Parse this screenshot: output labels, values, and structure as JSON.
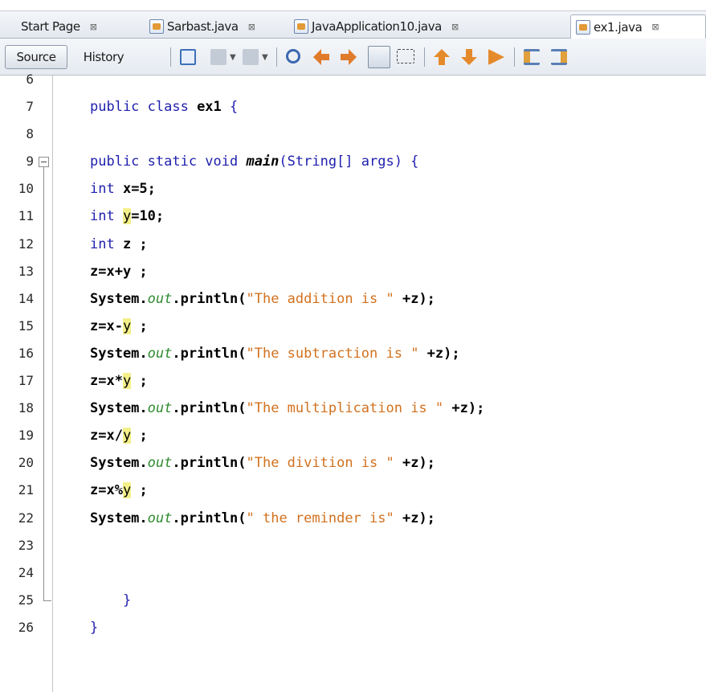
{
  "tabs": [
    {
      "label": "Start Page",
      "active": false,
      "icon": "none"
    },
    {
      "label": "Sarbast.java",
      "active": false,
      "icon": "java-file-icon"
    },
    {
      "label": "JavaApplication10.java",
      "active": false,
      "icon": "java-file-icon"
    },
    {
      "label": "ex1.java",
      "active": true,
      "icon": "java-file-icon"
    }
  ],
  "tab_close_glyph": "⊠",
  "toolbar": {
    "source_label": "Source",
    "history_label": "History",
    "icons": [
      "last-edit-icon",
      "back-icon",
      "forward-icon",
      "find-icon",
      "find-previous-icon",
      "find-next-icon",
      "toggle-highlight-icon",
      "rect-select-icon",
      "previous-bookmark-icon",
      "next-bookmark-icon",
      "toggle-bookmark-icon",
      "shift-left-icon",
      "shift-right-icon"
    ]
  },
  "editor": {
    "partial_top_line": "6",
    "lines": [
      {
        "n": "7",
        "segments": [
          [
            "kw",
            "public class "
          ],
          [
            "nm",
            "ex1"
          ],
          [
            "kw",
            " {"
          ]
        ]
      },
      {
        "n": "8",
        "segments": []
      },
      {
        "n": "9",
        "segments": [
          [
            "kw",
            "public static void "
          ],
          [
            "it",
            "main"
          ],
          [
            "kw",
            "(String[] args) {"
          ]
        ],
        "fold": "start"
      },
      {
        "n": "10",
        "segments": [
          [
            "kw",
            "int "
          ],
          [
            "nm",
            "x=5;"
          ]
        ]
      },
      {
        "n": "11",
        "segments": [
          [
            "kw",
            "int "
          ],
          [
            "hl",
            "y"
          ],
          [
            "nm",
            "=10;"
          ]
        ]
      },
      {
        "n": "12",
        "segments": [
          [
            "kw",
            "int "
          ],
          [
            "nm",
            "z ;"
          ]
        ]
      },
      {
        "n": "13",
        "segments": [
          [
            "nm",
            "z=x+y ;"
          ]
        ]
      },
      {
        "n": "14",
        "segments": [
          [
            "nm",
            "System."
          ],
          [
            "fld",
            "out"
          ],
          [
            "nm",
            ".println("
          ],
          [
            "str",
            "\"The addition is \""
          ],
          [
            "nm",
            " +z);"
          ]
        ]
      },
      {
        "n": "15",
        "segments": [
          [
            "nm",
            "z=x-"
          ],
          [
            "hl",
            "y"
          ],
          [
            "nm",
            " ;"
          ]
        ]
      },
      {
        "n": "16",
        "segments": [
          [
            "nm",
            "System."
          ],
          [
            "fld",
            "out"
          ],
          [
            "nm",
            ".println("
          ],
          [
            "str",
            "\"The subtraction is \""
          ],
          [
            "nm",
            " +z);"
          ]
        ]
      },
      {
        "n": "17",
        "segments": [
          [
            "nm",
            "z=x*"
          ],
          [
            "hl",
            "y"
          ],
          [
            "nm",
            " ;"
          ]
        ]
      },
      {
        "n": "18",
        "segments": [
          [
            "nm",
            "System."
          ],
          [
            "fld",
            "out"
          ],
          [
            "nm",
            ".println("
          ],
          [
            "str",
            "\"The multiplication is \""
          ],
          [
            "nm",
            " +z);"
          ]
        ]
      },
      {
        "n": "19",
        "segments": [
          [
            "nm",
            "z=x/"
          ],
          [
            "hl",
            "y"
          ],
          [
            "nm",
            " ;"
          ]
        ]
      },
      {
        "n": "20",
        "segments": [
          [
            "nm",
            "System."
          ],
          [
            "fld",
            "out"
          ],
          [
            "nm",
            ".println("
          ],
          [
            "str",
            "\"The divition is \""
          ],
          [
            "nm",
            " +z);"
          ]
        ]
      },
      {
        "n": "21",
        "segments": [
          [
            "nm",
            "z=x%"
          ],
          [
            "hl",
            "y"
          ],
          [
            "nm",
            " ;"
          ]
        ]
      },
      {
        "n": "22",
        "segments": [
          [
            "nm",
            "System."
          ],
          [
            "fld",
            "out"
          ],
          [
            "nm",
            ".println("
          ],
          [
            "str",
            "\" the reminder is\""
          ],
          [
            "nm",
            " +z);"
          ]
        ]
      },
      {
        "n": "23",
        "segments": []
      },
      {
        "n": "24",
        "segments": []
      },
      {
        "n": "25",
        "segments": [
          [
            "kw",
            "    }"
          ]
        ],
        "fold": "end"
      },
      {
        "n": "26",
        "segments": [
          [
            "kw",
            "}"
          ]
        ]
      }
    ]
  },
  "colors": {
    "keyword": "#1f1fae",
    "string": "#d2711e",
    "field": "#2e8b2e",
    "highlight": "#f3f08a"
  }
}
